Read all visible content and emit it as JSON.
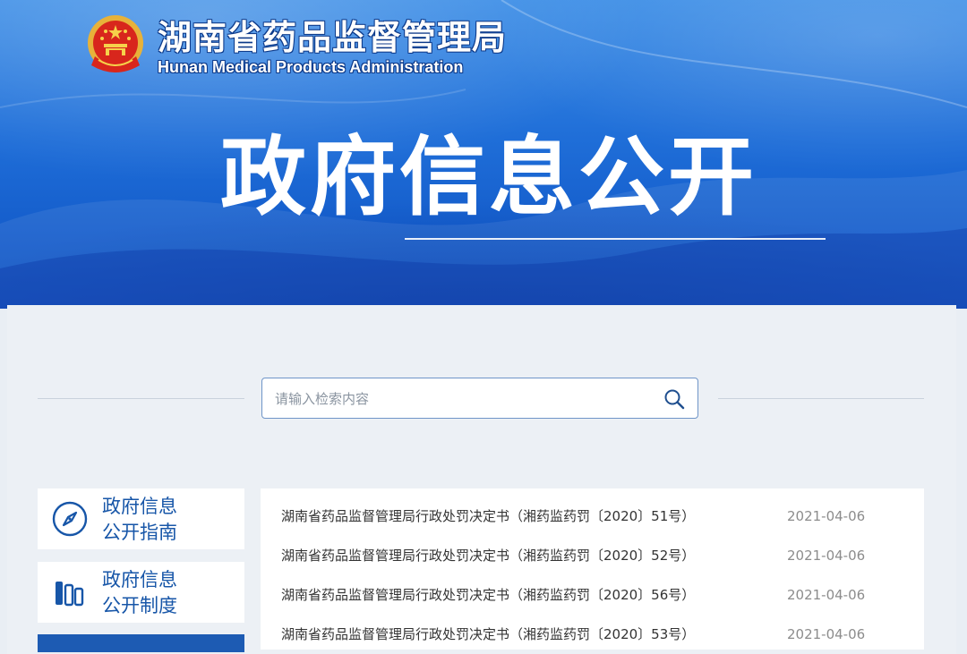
{
  "header": {
    "site_title": "湖南省药品监督管理局",
    "site_subtitle": "Hunan Medical Products Administration",
    "emblem_icon": "national-emblem-icon",
    "section_title": "政府信息公开"
  },
  "search": {
    "placeholder": "请输入检索内容",
    "icon": "search-icon"
  },
  "sidebar": {
    "items": [
      {
        "label_line1": "政府信息",
        "label_line2": "公开指南",
        "icon": "compass-icon"
      },
      {
        "label_line1": "政府信息",
        "label_line2": "公开制度",
        "icon": "bookshelf-icon"
      }
    ]
  },
  "news": [
    {
      "title": "湖南省药品监督管理局行政处罚决定书（湘药监药罚〔2020〕51号）",
      "date": "2021-04-06"
    },
    {
      "title": "湖南省药品监督管理局行政处罚决定书（湘药监药罚〔2020〕52号）",
      "date": "2021-04-06"
    },
    {
      "title": "湖南省药品监督管理局行政处罚决定书（湘药监药罚〔2020〕56号）",
      "date": "2021-04-06"
    },
    {
      "title": "湖南省药品监督管理局行政处罚决定书（湘药监药罚〔2020〕53号）",
      "date": "2021-04-06"
    }
  ],
  "colors": {
    "banner_top": "#3d8ee6",
    "banner_bottom": "#0c4fc1",
    "accent_blue": "#1756a8",
    "active_card": "#1d5bb3"
  }
}
